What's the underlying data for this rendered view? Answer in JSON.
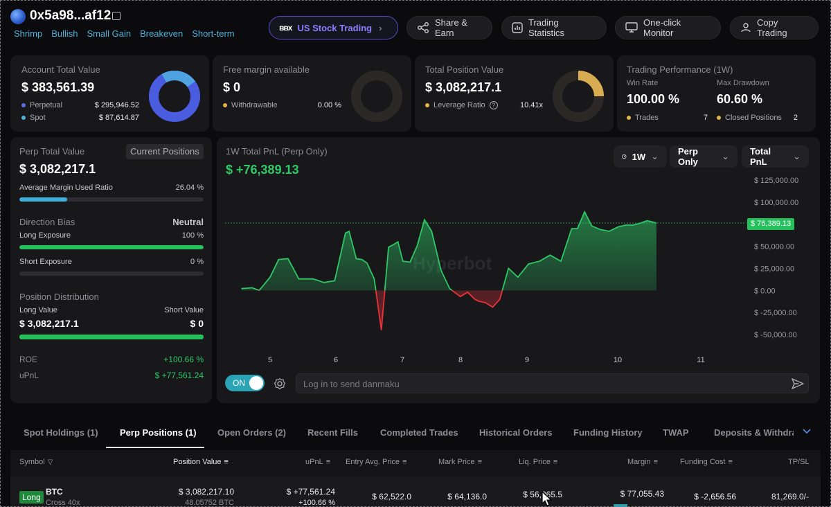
{
  "header": {
    "address": "0x5a98...af12",
    "tags": [
      "Shrimp",
      "Bullish",
      "Small Gain",
      "Breakeven",
      "Short-term"
    ],
    "buttons": {
      "us_stock": "US Stock Trading",
      "share": "Share & Earn",
      "stats": "Trading Statistics",
      "monitor": "One-click Monitor",
      "copy": "Copy Trading"
    }
  },
  "account": {
    "title": "Account Total Value",
    "value": "$ 383,561.39",
    "perp_label": "Perpetual",
    "perp_value": "$ 295,946.52",
    "spot_label": "Spot",
    "spot_value": "$ 87,614.87"
  },
  "margin": {
    "title": "Free margin available",
    "value": "$ 0",
    "withdrawable_label": "Withdrawable",
    "withdrawable_value": "0.00 %"
  },
  "position": {
    "title": "Total Position Value",
    "value": "$ 3,082,217.1",
    "leverage_label": "Leverage Ratio",
    "leverage_value": "10.41x"
  },
  "performance": {
    "title": "Trading Performance (1W)",
    "win_rate_label": "Win Rate",
    "win_rate": "100.00 %",
    "drawdown_label": "Max Drawdown",
    "drawdown": "60.60 %",
    "trades_label": "Trades",
    "trades": "7",
    "closed_label": "Closed Positions",
    "closed": "2"
  },
  "perp": {
    "title": "Perp Total Value",
    "current_btn": "Current Positions",
    "value": "$ 3,082,217.1",
    "margin_ratio_label": "Average Margin Used Ratio",
    "margin_ratio": "26.04 %",
    "margin_ratio_fraction": 0.2604,
    "bias_label": "Direction Bias",
    "bias_value": "Neutral",
    "long_exp_label": "Long Exposure",
    "long_exp": "100 %",
    "long_exp_fraction": 1.0,
    "short_exp_label": "Short Exposure",
    "short_exp": "0 %",
    "short_exp_fraction": 0.0,
    "dist_label": "Position Distribution",
    "long_value_label": "Long Value",
    "long_value": "$ 3,082,217.1",
    "short_value_label": "Short Value",
    "short_value": "$ 0",
    "roe_label": "ROE",
    "roe": "+100.66 %",
    "upnl_label": "uPnL",
    "upnl": "$ +77,561.24"
  },
  "chart": {
    "title": "1W Total PnL (Perp Only)",
    "value": "$ +76,389.13",
    "current_label": "$ 76,389.13",
    "watermark": "Hyperbot",
    "period": "1W",
    "scope": "Perp Only",
    "metric": "Total PnL",
    "toggle": "ON",
    "danmaku_placeholder": "Log in to send danmaku",
    "colors": {
      "up": "#2ec866",
      "down": "#e8323a"
    }
  },
  "chart_data": {
    "type": "area",
    "x_tick_labels": [
      "5",
      "6",
      "7",
      "8",
      "9",
      "10",
      "11"
    ],
    "y_tick_labels": [
      "$ 125,000.00",
      "$ 100,000.00",
      "$ 75,000.00",
      "$ 50,000.00",
      "$ 25,000.00",
      "$ 0.00",
      "$ -25,000.00",
      "$ -50,000.00"
    ],
    "ylim": [
      -50000,
      125000
    ],
    "x": [
      4.6,
      4.75,
      4.85,
      5.0,
      5.12,
      5.25,
      5.4,
      5.6,
      5.75,
      5.9,
      6.05,
      6.1,
      6.2,
      6.28,
      6.35,
      6.45,
      6.55,
      6.65,
      6.72,
      6.78,
      6.85,
      6.95,
      7.05,
      7.15,
      7.25,
      7.38,
      7.5,
      7.65,
      7.75,
      7.85,
      7.9,
      8.0,
      8.1,
      8.2,
      8.32,
      8.45,
      8.6,
      8.75,
      8.9,
      9.05,
      9.2,
      9.28,
      9.38,
      9.48,
      9.6,
      9.72,
      9.85,
      9.95,
      10.05,
      10.15,
      10.25,
      10.38,
      10.55,
      10.7,
      10.85,
      11.0,
      11.15,
      11.3,
      11.45,
      11.55
    ],
    "values": [
      2000,
      3000,
      0,
      15000,
      35000,
      36000,
      13000,
      13000,
      9000,
      11000,
      65000,
      67000,
      36000,
      35000,
      31000,
      13000,
      -45000,
      49000,
      52000,
      55000,
      33000,
      32000,
      51000,
      80000,
      67000,
      23000,
      2000,
      -7000,
      -2000,
      -10000,
      -12000,
      -14000,
      -19000,
      -10000,
      25000,
      15000,
      30000,
      33000,
      40000,
      33000,
      70000,
      70000,
      89000,
      73000,
      69000,
      67000,
      72000,
      74000,
      74000,
      76000,
      79000,
      76389
    ],
    "series": [
      {
        "name": "",
        "values": []
      }
    ],
    "grid": false
  },
  "tabs": [
    "Spot Holdings (1)",
    "Perp Positions (1)",
    "Open Orders (2)",
    "Recent Fills",
    "Completed Trades",
    "Historical Orders",
    "Funding History",
    "TWAP",
    "Deposits & Withdraw"
  ],
  "table": {
    "headers": [
      "Symbol",
      "Position Value",
      "uPnL",
      "Entry Avg. Price",
      "Mark Price",
      "Liq. Price",
      "Margin",
      "Funding Cost",
      "TP/SL"
    ],
    "row": {
      "side": "Long",
      "symbol": "BTC",
      "mode": "Cross 40x",
      "position_value": "$ 3,082,217.10",
      "position_size": "48.05752 BTC",
      "upnl": "$ +77,561.24",
      "upnl_pct": "+100.66 %",
      "entry": "$ 62,522.0",
      "mark": "$ 64,136.0",
      "liq": "$ 56,865.5",
      "margin": "$ 77,055.43",
      "funding": "$ -2,656.56",
      "tpsl": "81,269.0/-"
    }
  }
}
